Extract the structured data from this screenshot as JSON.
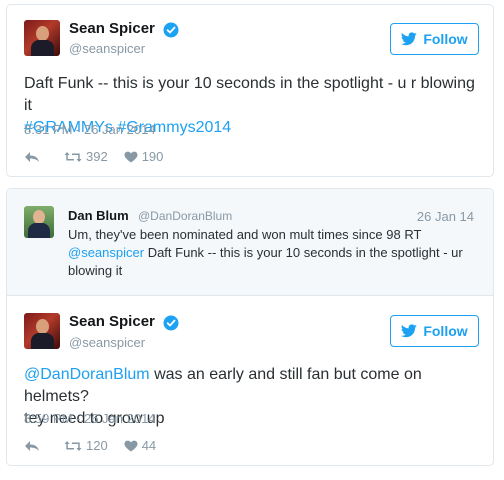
{
  "tweet1": {
    "name": "Sean Spicer",
    "handle": "@seanspicer",
    "follow_label": "Follow",
    "text_plain": "Daft Funk -- this is your 10 seconds in the spotlight - u r blowing it",
    "hashtag1": "#GRAMMYs",
    "hashtag2": "#Grammys2014",
    "timestamp": "8:31 PM - 26 Jan 2014",
    "retweets": "392",
    "likes": "190"
  },
  "quoted": {
    "name": "Dan Blum",
    "handle": "@DanDoranBlum",
    "date": "26 Jan 14",
    "line1": "Um, they've been nominated and won mult times since 98 RT",
    "mention": "@seanspicer",
    "line2_rest": " Daft Funk -- this is your 10 seconds in the spotlight - ur",
    "line3": "blowing it"
  },
  "tweet2": {
    "name": "Sean Spicer",
    "handle": "@seanspicer",
    "follow_label": "Follow",
    "mention": "@DanDoranBlum",
    "text_line1_rest": " was an early and still fan but come on helmets?",
    "text_line2": "tey need to grow up",
    "timestamp": "8:59 PM - 26 Jan 2014",
    "retweets": "120",
    "likes": "44"
  },
  "colors": {
    "accent": "#1da1f2",
    "muted": "#8899a6",
    "text": "#292f33",
    "border": "#e1e8ed"
  },
  "icons": [
    "verified-icon",
    "twitter-bird-icon",
    "reply-icon",
    "retweet-icon",
    "heart-icon"
  ]
}
